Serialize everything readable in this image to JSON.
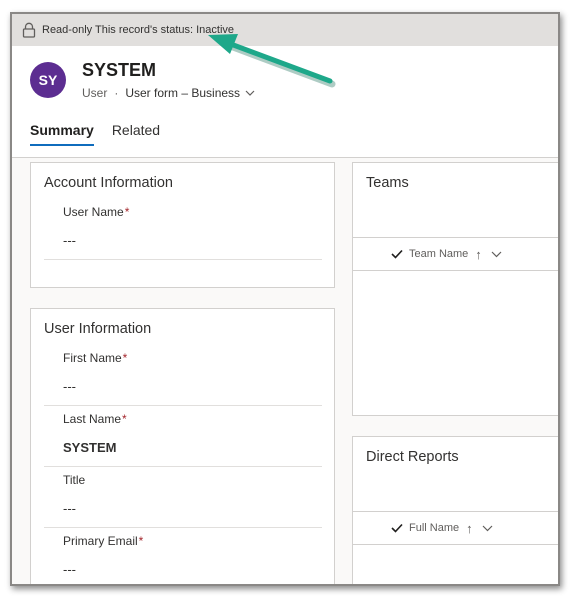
{
  "notice": {
    "text": "Read-only This record's status: Inactive",
    "icon": "lock-icon"
  },
  "record": {
    "initials": "SY",
    "name": "SYSTEM",
    "entity": "User",
    "separator": "·",
    "form_name": "User form – Business"
  },
  "tabs": [
    {
      "label": "Summary",
      "active": true
    },
    {
      "label": "Related",
      "active": false
    }
  ],
  "account_info": {
    "title": "Account Information",
    "fields": [
      {
        "label": "User Name",
        "required": "*",
        "value": "---"
      }
    ]
  },
  "user_info": {
    "title": "User Information",
    "fields": [
      {
        "label": "First Name",
        "required": "*",
        "value": "---"
      },
      {
        "label": "Last Name",
        "required": "*",
        "value": "SYSTEM"
      },
      {
        "label": "Title",
        "required": "",
        "value": "---"
      },
      {
        "label": "Primary Email",
        "required": "*",
        "value": "---"
      }
    ]
  },
  "teams": {
    "title": "Teams",
    "column": "Team Name",
    "sort": "↑"
  },
  "direct_reports": {
    "title": "Direct Reports",
    "column": "Full Name",
    "sort": "↑"
  },
  "colors": {
    "accent": "#0f6cbd",
    "avatar": "#5c2d91",
    "required": "#a4262c",
    "annotation_arrow": "#1ea88a",
    "notice_bg": "#e1dfdd"
  }
}
